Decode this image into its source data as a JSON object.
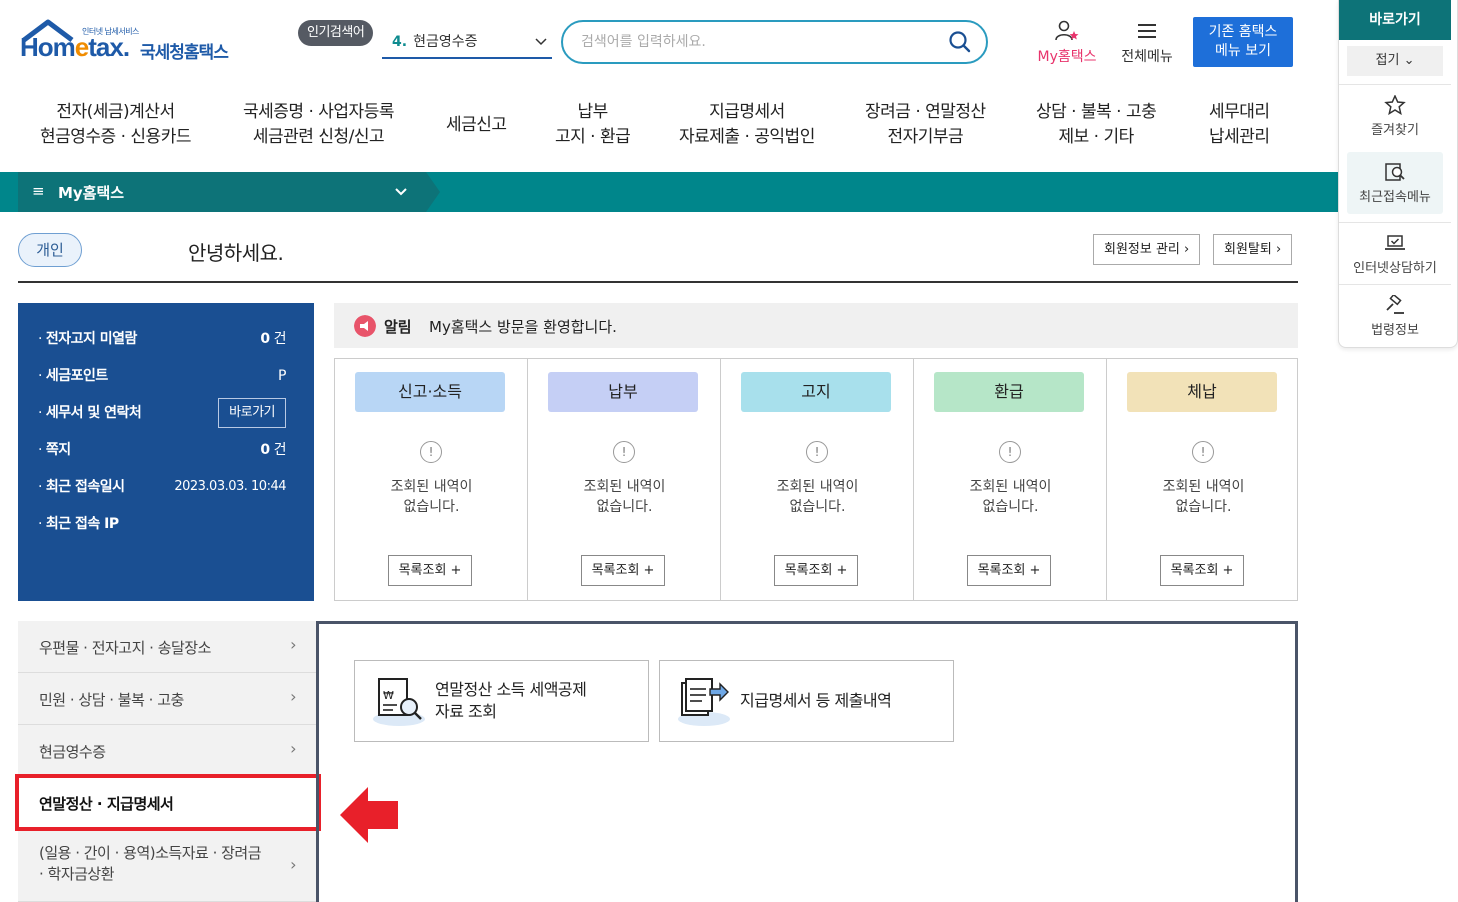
{
  "header": {
    "logo_small": "인터넷 납세서비스",
    "logo_main_a": "Hom",
    "logo_main_e": "e",
    "logo_main_b": "tax.",
    "logo_sub": "국세청홈택스",
    "popular_label": "인기검색어",
    "popular_num": "4.",
    "popular_term": "현금영수증",
    "search_placeholder": "검색어를 입력하세요.",
    "myhome": "My홈택스",
    "allmenu": "전체메뉴",
    "old_menu_line1": "기존 홈택스",
    "old_menu_line2": "메뉴 보기"
  },
  "gnb": [
    {
      "l1": "전자(세금)계산서",
      "l2": "현금영수증 · 신용카드"
    },
    {
      "l1": "국세증명 · 사업자등록",
      "l2": "세금관련 신청/신고"
    },
    {
      "l1": "세금신고",
      "l2": ""
    },
    {
      "l1": "납부",
      "l2": "고지 · 환급"
    },
    {
      "l1": "지급명세서",
      "l2": "자료제출 · 공익법인"
    },
    {
      "l1": "장려금 · 연말정산",
      "l2": "전자기부금"
    },
    {
      "l1": "상담 · 불복 · 고충",
      "l2": "제보 · 기타"
    },
    {
      "l1": "세무대리",
      "l2": "납세관리"
    }
  ],
  "lnb": {
    "burger": "≡",
    "title": "My홈택스",
    "chevron": "⌄"
  },
  "greeting": {
    "user_type": "개인",
    "text": "안녕하세요.",
    "member_btn": "회원정보 관리 ›",
    "withdraw_btn": "회원탈퇴 ›"
  },
  "info": {
    "rows": [
      {
        "label": "전자고지 미열람",
        "value": "0",
        "unit": "건"
      },
      {
        "label": "세금포인트",
        "value": "",
        "unit": "P"
      },
      {
        "label": "세무서 및 연락처",
        "button": "바로가기"
      },
      {
        "label": "쪽지",
        "value": "0",
        "unit": "건"
      },
      {
        "label": "최근 접속일시",
        "value": "2023.03.03.  10:44",
        "unit": ""
      },
      {
        "label": "최근 접속 IP",
        "value": "",
        "unit": ""
      }
    ]
  },
  "notice": {
    "label": "알림",
    "text": "My홈택스 방문을 환영합니다."
  },
  "cards": [
    {
      "tag": "신고·소득",
      "color": "#b8d6f5",
      "msg1": "조회된 내역이",
      "msg2": "없습니다.",
      "btn": "목록조회 +",
      "excl": "!"
    },
    {
      "tag": "납부",
      "color": "#c5cff5",
      "msg1": "조회된 내역이",
      "msg2": "없습니다.",
      "btn": "목록조회 +",
      "excl": "!"
    },
    {
      "tag": "고지",
      "color": "#a8e0ec",
      "msg1": "조회된 내역이",
      "msg2": "없습니다.",
      "btn": "목록조회 +",
      "excl": "!"
    },
    {
      "tag": "환급",
      "color": "#b6e6c8",
      "msg1": "조회된 내역이",
      "msg2": "없습니다.",
      "btn": "목록조회 +",
      "excl": "!"
    },
    {
      "tag": "체납",
      "color": "#f2e2b8",
      "msg1": "조회된 내역이",
      "msg2": "없습니다.",
      "btn": "목록조회 +",
      "excl": "!"
    }
  ],
  "side_menu": [
    {
      "label": "우편물 · 전자고지 · 송달장소",
      "arrow": "›"
    },
    {
      "label": "민원 · 상담 · 불복 · 고충",
      "arrow": "›"
    },
    {
      "label": "현금영수증",
      "arrow": "›"
    },
    {
      "label": "연말정산 · 지급명세서",
      "arrow": ""
    },
    {
      "label": "(일용 · 간이 · 용역)소득자료 · 장려금 · 학자금상환",
      "arrow": "›"
    }
  ],
  "tiles": [
    {
      "line1": "연말정산 소득 세액공제",
      "line2": "자료 조회"
    },
    {
      "line1": "지급명세서 등 제출내역",
      "line2": ""
    }
  ],
  "quick": {
    "title": "바로가기",
    "fold": "접기 ⌄",
    "items": [
      "즐겨찾기",
      "최근접속메뉴",
      "인터넷상담하기",
      "법령정보"
    ]
  },
  "colors": {
    "teal": "#00868b",
    "navy": "#1a4f92",
    "accent_red": "#e8202a",
    "brand_blue": "#1e5aa8"
  }
}
